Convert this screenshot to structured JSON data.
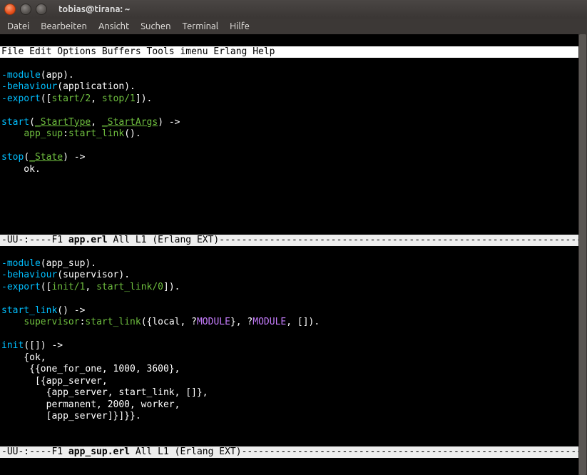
{
  "window": {
    "title": "tobias@tirana: ~"
  },
  "menubar": {
    "items": [
      "Datei",
      "Bearbeiten",
      "Ansicht",
      "Suchen",
      "Terminal",
      "Hilfe"
    ]
  },
  "emacs_menu": "File Edit Options Buffers Tools imenu Erlang Help",
  "modeline1": {
    "prefix": "-UU-:----F1  ",
    "file": "app.erl",
    "pad": "       ",
    "pos": "All L1    ",
    "mode": " (Erlang EXT)",
    "dashes": "-----------------------------------------------------------------------"
  },
  "modeline2": {
    "prefix": "-UU-:----F1  ",
    "file": "app_sup.erl",
    "pad": "   ",
    "pos": "All L1    ",
    "mode": " (Erlang EXT)",
    "dashes": "-----------------------------------------------------------------------"
  },
  "buf1": {
    "l1a": "-module",
    "l1b": "(app).",
    "l2a": "-behaviour",
    "l2b": "(application).",
    "l3a": "-export",
    "l3b": "([",
    "l3c": "start/2",
    "l3d": ", ",
    "l3e": "stop/1",
    "l3f": "]).",
    "l5a": "start",
    "l5b": "(",
    "l5c": "_StartType",
    "l5d": ", ",
    "l5e": "_StartArgs",
    "l5f": ") ->",
    "l6a": "    ",
    "l6b": "app_sup",
    "l6c": ":",
    "l6d": "start_link",
    "l6e": "().",
    "l8a": "stop",
    "l8b": "(",
    "l8c": "_State",
    "l8d": ") ->",
    "l9": "    ok."
  },
  "buf2": {
    "l1a": "-module",
    "l1b": "(app_sup).",
    "l2a": "-behaviour",
    "l2b": "(supervisor).",
    "l3a": "-export",
    "l3b": "([",
    "l3c": "init/1",
    "l3d": ", ",
    "l3e": "start_link/0",
    "l3f": "]).",
    "l5a": "start_link",
    "l5b": "() ->",
    "l6a": "    ",
    "l6b": "supervisor",
    "l6c": ":",
    "l6d": "start_link",
    "l6e": "({local, ?",
    "l6f": "MODULE",
    "l6g": "}, ?",
    "l6h": "MODULE",
    "l6i": ", []).",
    "l8a": "init",
    "l8b": "([]) ->",
    "l9": "    {ok,",
    "l10": "     {{one_for_one, 1000, 3600},",
    "l11": "      [{app_server,",
    "l12": "        {app_server, start_link, []},",
    "l13": "        permanent, 2000, worker,",
    "l14": "        [app_server]}]}}."
  }
}
